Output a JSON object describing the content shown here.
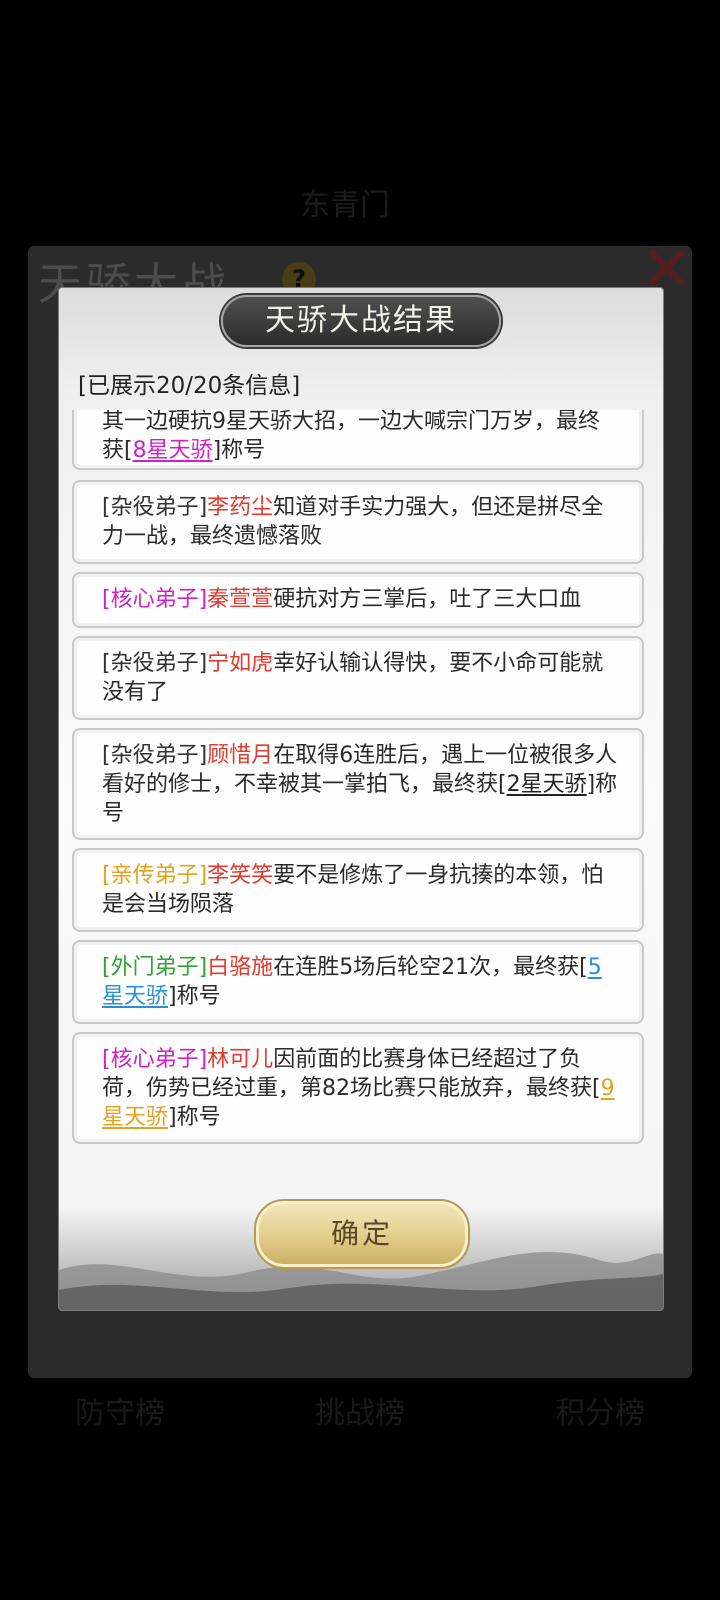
{
  "colors": {
    "rank_core": "#cc22cc",
    "rank_inner_disciple": "#e6a11f",
    "rank_outer": "#2fa52f",
    "rank_servant": "#333333",
    "name": "#e03a2f",
    "title_8star": "#cc22cc",
    "title_2star": "#222222",
    "title_5star": "#2a8fd6",
    "title_9star": "#e6a11f"
  },
  "background": {
    "title": "天骄大战",
    "help_icon": "?",
    "ghost_label": "东青门",
    "tabs": [
      "防守榜",
      "挑战榜",
      "积分榜"
    ]
  },
  "dialog": {
    "title": "天骄大战结果",
    "shown_count": "[已展示20/20条信息]",
    "confirm_label": "确定"
  },
  "entries": [
    {
      "rank": "",
      "name": "",
      "text": "其一边硬抗9星天骄大招，一边大喊宗门万岁，最终获[",
      "title": "8星天骄",
      "suffix": "]称号"
    },
    {
      "rank": "[杂役弟子]",
      "name": "李药尘",
      "text": "知道对手实力强大，但还是拼尽全力一战，最终遗憾落败",
      "title": "",
      "suffix": ""
    },
    {
      "rank": "[核心弟子]",
      "name": "秦萱萱",
      "text": "硬抗对方三掌后，吐了三大口血",
      "title": "",
      "suffix": ""
    },
    {
      "rank": "[杂役弟子]",
      "name": "宁如虎",
      "text": "幸好认输认得快，要不小命可能就没有了",
      "title": "",
      "suffix": ""
    },
    {
      "rank": "[杂役弟子]",
      "name": "顾惜月",
      "text": "在取得6连胜后，遇上一位被很多人看好的修士，不幸被其一掌拍飞，最终获[",
      "title": "2星天骄",
      "suffix": "]称号"
    },
    {
      "rank": "[亲传弟子]",
      "name": "李笑笑",
      "text": "要不是修炼了一身抗揍的本领，怕是会当场陨落",
      "title": "",
      "suffix": ""
    },
    {
      "rank": "[外门弟子]",
      "name": "白骆施",
      "text": "在连胜5场后轮空21次，最终获[",
      "title": "5星天骄",
      "suffix": "]称号"
    },
    {
      "rank": "[核心弟子]",
      "name": "林可儿",
      "text": "因前面的比赛身体已经超过了负荷，伤势已经过重，第82场比赛只能放弃，最终获[",
      "title": "9星天骄",
      "suffix": "]称号"
    }
  ]
}
